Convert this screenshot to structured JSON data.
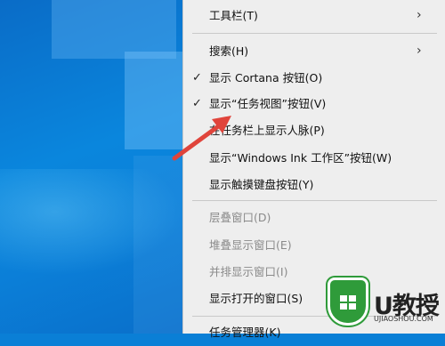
{
  "menu": {
    "items": [
      {
        "label": "工具栏(T)",
        "checked": false,
        "disabled": false,
        "submenu": true
      },
      {
        "label": "搜索(H)",
        "checked": false,
        "disabled": false,
        "submenu": true
      },
      {
        "label": "显示 Cortana 按钮(O)",
        "checked": true,
        "disabled": false,
        "submenu": false
      },
      {
        "label": "显示“任务视图”按钮(V)",
        "checked": true,
        "disabled": false,
        "submenu": false
      },
      {
        "label": "在任务栏上显示人脉(P)",
        "checked": false,
        "disabled": false,
        "submenu": false
      },
      {
        "label": "显示“Windows Ink 工作区”按钮(W)",
        "checked": false,
        "disabled": false,
        "submenu": false
      },
      {
        "label": "显示触摸键盘按钮(Y)",
        "checked": false,
        "disabled": false,
        "submenu": false
      },
      {
        "label": "层叠窗口(D)",
        "checked": false,
        "disabled": true,
        "submenu": false
      },
      {
        "label": "堆叠显示窗口(E)",
        "checked": false,
        "disabled": true,
        "submenu": false
      },
      {
        "label": "并排显示窗口(I)",
        "checked": false,
        "disabled": true,
        "submenu": false
      },
      {
        "label": "显示打开的窗口(S)",
        "checked": false,
        "disabled": false,
        "submenu": false
      },
      {
        "label": "任务管理器(K)",
        "checked": false,
        "disabled": false,
        "submenu": false
      }
    ]
  },
  "watermark": {
    "brand": "U教授",
    "url": "UJIAOSHOU.COM"
  },
  "colors": {
    "menu_bg": "#eeeeee",
    "disabled_text": "#8a8a8a",
    "annotation_arrow": "#e0443b",
    "logo_green": "#2f9b3a"
  }
}
